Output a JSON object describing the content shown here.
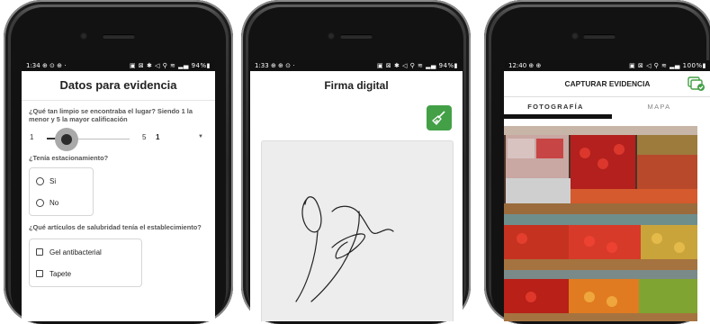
{
  "screen1": {
    "status": {
      "time": "1:34",
      "left_icons": "⊕ ⊙ ⊕ ·",
      "battery": "94%"
    },
    "title": "Datos para evidencia",
    "question1": "¿Qué tan limpio se encontraba el lugar? Siendo 1 la menor y 5 la mayor calificación",
    "slider": {
      "min_label": "1",
      "max_label": "5",
      "selected": "1"
    },
    "question2": "¿Tenía estacionamiento?",
    "radio_options": [
      "Si",
      "No"
    ],
    "question3": "¿Qué artículos de salubridad tenía el establecimiento?",
    "check_options": [
      "Gel antibacterial",
      "Tapete"
    ]
  },
  "screen2": {
    "status": {
      "time": "1:33",
      "left_icons": "⊕ ⊕ ⊙ ·",
      "battery": "94%"
    },
    "title": "Firma digital",
    "accent": "#43a047"
  },
  "screen3": {
    "status": {
      "time": "12:40",
      "left_icons": "⊕ ⊕",
      "battery": "100%"
    },
    "title": "CAPTURAR EVIDENCIA",
    "tabs": [
      "FOTOGRAFÍA",
      "MAPA"
    ],
    "active_tab": "FOTOGRAFÍA",
    "accent": "#43a047"
  }
}
